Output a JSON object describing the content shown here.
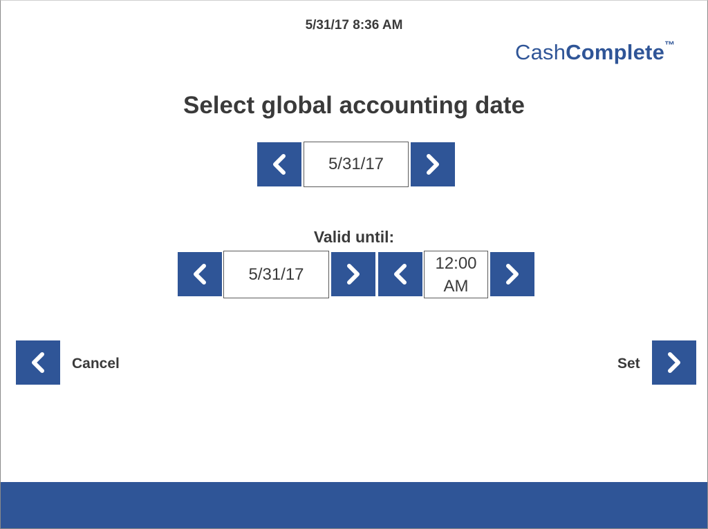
{
  "header": {
    "datetime": "5/31/17 8:36 AM",
    "logo_regular": "Cash",
    "logo_bold": "Complete",
    "logo_tm": "™"
  },
  "title": "Select global accounting date",
  "accounting_date": {
    "value": "5/31/17"
  },
  "valid_until": {
    "label": "Valid until:",
    "date": "5/31/17",
    "time_line1": "12:00",
    "time_line2": "AM"
  },
  "navigation": {
    "cancel_label": "Cancel",
    "set_label": "Set"
  },
  "icons": {
    "previous": "chevron-left-icon",
    "next": "chevron-right-icon"
  },
  "colors": {
    "accent": "#2f5597",
    "text": "#3a3a3a",
    "background": "#ffffff"
  }
}
